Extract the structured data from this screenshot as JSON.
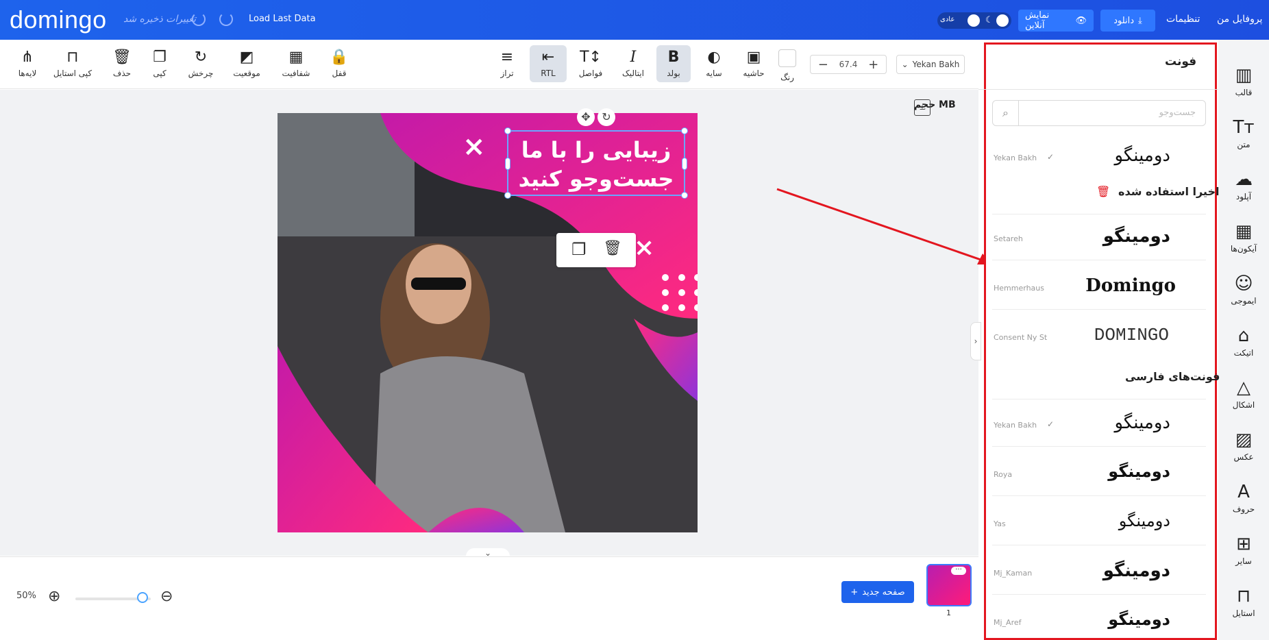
{
  "topbar": {
    "logo": "domingo",
    "saved_status": "تغییرات ذخیره شد",
    "load_last_data": "Load Last Data",
    "mode_label": "عادی",
    "online_view": "نمایش آنلاین",
    "download": "دانلود",
    "settings": "تنظیمات",
    "profile": "پروفایل من"
  },
  "toolbar": {
    "font_name": "Yekan Bakh",
    "font_size": "67.4",
    "tools": {
      "color": "رنگ",
      "border": "حاشیه",
      "shadow": "سایه",
      "bold": "بولد",
      "italic": "ایتالیک",
      "spacing": "فواصل",
      "rtl": "RTL",
      "align": "تراز",
      "lock": "قفل",
      "opacity": "شفافیت",
      "position": "موقعیت",
      "rotate": "چرخش",
      "copy": "کپی",
      "delete": "حذف",
      "copy_style": "کپی استایل",
      "layers": "لایه‌ها"
    }
  },
  "canvas": {
    "file_size_label": "حجم MB",
    "headline_line1": "زیبایی را با ما",
    "headline_line2": "جست‌وجو کنید",
    "colors": {
      "magenta": "#c41aa8",
      "pink": "#ff2a7f",
      "purple": "#8f34d9"
    }
  },
  "bottombar": {
    "zoom": "50%",
    "new_page": "صفحه جدید",
    "page_number": "1"
  },
  "sidebar": {
    "items": [
      {
        "label": "قالب",
        "icon": "template-icon"
      },
      {
        "label": "متن",
        "icon": "text-icon"
      },
      {
        "label": "آپلود",
        "icon": "upload-icon"
      },
      {
        "label": "آیکون‌ها",
        "icon": "icons-grid-icon"
      },
      {
        "label": "ایموجی",
        "icon": "emoji-icon"
      },
      {
        "label": "اتیکت",
        "icon": "tag-icon"
      },
      {
        "label": "اشکال",
        "icon": "shapes-icon"
      },
      {
        "label": "عکس",
        "icon": "image-icon"
      },
      {
        "label": "حروف",
        "icon": "letters-icon"
      },
      {
        "label": "سایر",
        "icon": "more-icon"
      },
      {
        "label": "استایل",
        "icon": "style-icon"
      }
    ]
  },
  "font_panel": {
    "title": "فونت",
    "search_placeholder": "جست‌وجو",
    "recent_title": "اخیرا استفاده شده",
    "persian_title": "فونت‌های فارسی",
    "rows": [
      {
        "name": "Yekan Bakh",
        "sample": "دومینگو"
      },
      {
        "name": "Setareh",
        "sample": "دومینگو"
      },
      {
        "name": "Hemmerhaus",
        "sample": "Domingo"
      },
      {
        "name": "Consent Ny St",
        "sample": "DOMINGO"
      },
      {
        "name": "Yekan Bakh",
        "sample": "دومینگو"
      },
      {
        "name": "Roya",
        "sample": "دومینگو"
      },
      {
        "name": "Yas",
        "sample": "دومینگو"
      },
      {
        "name": "Mj_Kaman",
        "sample": "دومینگو"
      },
      {
        "name": "Mj_Aref",
        "sample": "دومینگو"
      }
    ]
  }
}
